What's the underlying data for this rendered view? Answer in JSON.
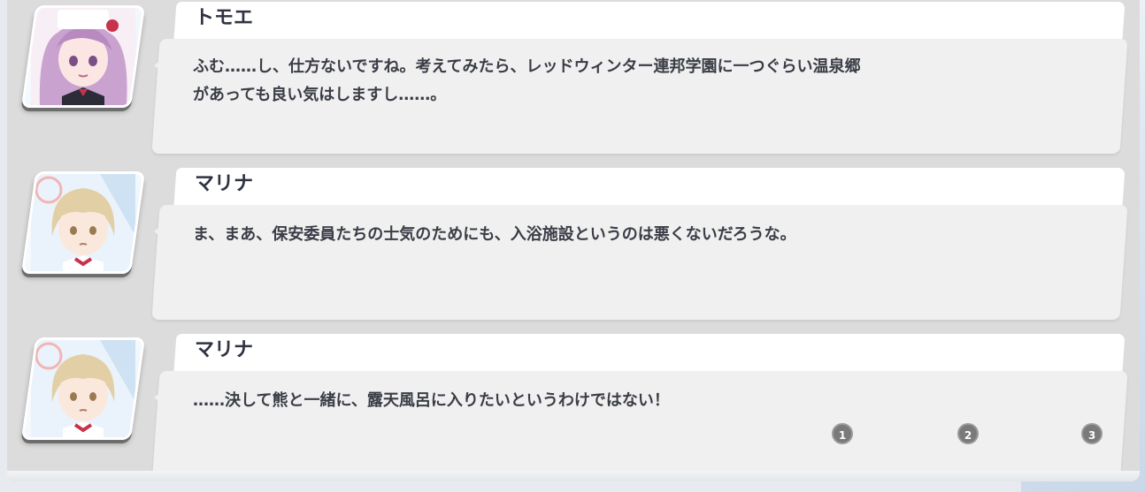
{
  "dialogue": [
    {
      "speaker": "トモエ",
      "message": "ふむ……し、仕方ないですね。考えてみたら、レッドウィンター連邦学園に一つぐらい温泉郷\nがあっても良い気はしますし……。"
    },
    {
      "speaker": "マリナ",
      "message": "ま、まあ、保安委員たちの士気のためにも、入浴施設というのは悪くないだろうな。"
    },
    {
      "speaker": "マリナ",
      "message": "……決して熊と一緒に、露天風呂に入りたいというわけではない！"
    }
  ],
  "choices": [
    "1",
    "2",
    "3"
  ],
  "colors": {
    "panel": "#dcdcdc",
    "bubble": "#f0f0f0",
    "name_plate": "#ffffff",
    "text": "#3a3d46",
    "choice_badge": "#7a7a7a"
  },
  "icons": [
    "tomoe-portrait-icon",
    "marina-portrait-icon"
  ]
}
